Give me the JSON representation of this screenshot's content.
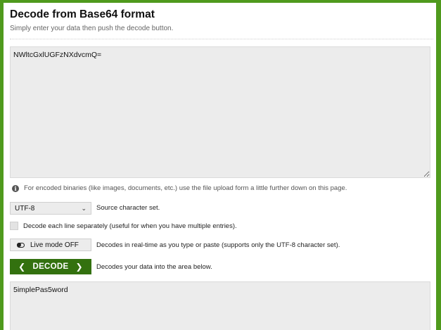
{
  "header": {
    "title": "Decode from Base64 format",
    "subtitle": "Simply enter your data then push the decode button."
  },
  "input": {
    "value": "NWltcGxlUGFzNXdvcmQ="
  },
  "info": {
    "text": "For encoded binaries (like images, documents, etc.) use the file upload form a little further down on this page."
  },
  "charset": {
    "selected": "UTF-8",
    "label": "Source character set."
  },
  "each_line": {
    "checked": false,
    "label": "Decode each line separately (useful for when you have multiple entries)."
  },
  "live_mode": {
    "button_label": "Live mode OFF",
    "label": "Decodes in real-time as you type or paste (supports only the UTF-8 character set)."
  },
  "decode": {
    "button_label": "DECODE",
    "label": "Decodes your data into the area below."
  },
  "output": {
    "value": "5implePas5word"
  },
  "colors": {
    "frame": "#4f9a1d",
    "button": "#33710f",
    "field_bg": "#ececec"
  }
}
